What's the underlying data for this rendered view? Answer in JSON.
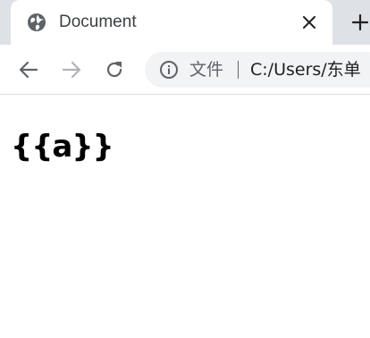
{
  "tab": {
    "title": "Document",
    "favicon_icon": "globe-icon",
    "close_icon": "close-icon"
  },
  "tabstrip": {
    "new_tab_icon": "plus-icon"
  },
  "toolbar": {
    "back_icon": "arrow-left-icon",
    "forward_icon": "arrow-right-icon",
    "reload_icon": "reload-icon"
  },
  "omnibox": {
    "info_icon": "info-icon",
    "scheme_label": "文件",
    "url": "C:/Users/东单"
  },
  "page": {
    "heading": "{{a}}"
  },
  "colors": {
    "tabstrip_bg": "#dee1e6",
    "omnibox_bg": "#f1f3f4",
    "icon_color": "#5f6368",
    "disabled_icon_color": "#b0b3b8"
  }
}
